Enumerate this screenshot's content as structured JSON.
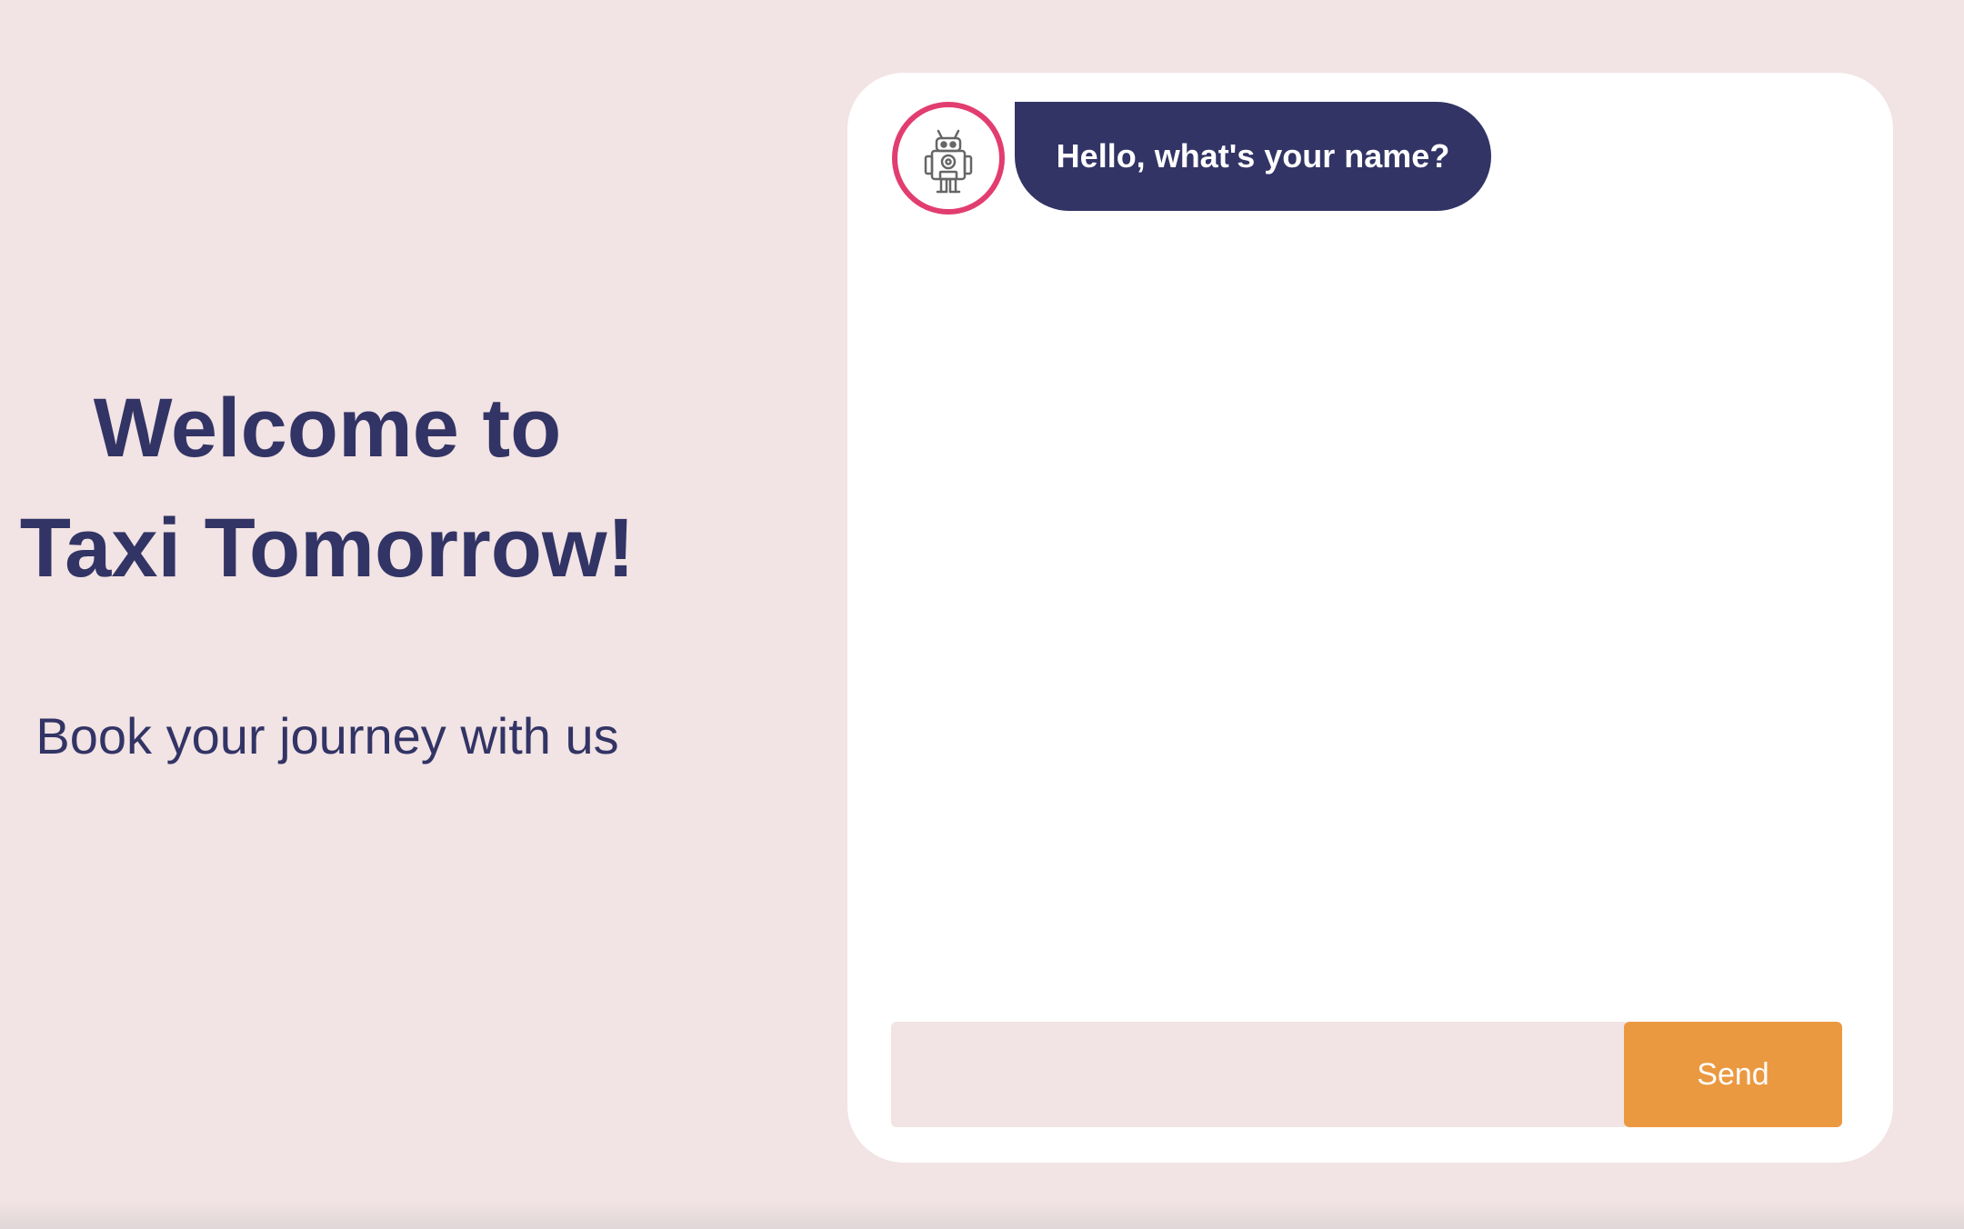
{
  "hero": {
    "title_line1": "Welcome to",
    "title_line2": "Taxi Tomorrow!",
    "subtitle": "Book your journey with us"
  },
  "chat": {
    "avatar_icon": "robot-icon",
    "messages": [
      {
        "sender": "bot",
        "text": "Hello, what's your name?"
      }
    ],
    "input": {
      "value": "",
      "placeholder": ""
    },
    "send_label": "Send"
  },
  "colors": {
    "background": "#f2e3e4",
    "primary": "#323465",
    "accent": "#e23d70",
    "button": "#eb9940",
    "card": "#ffffff"
  }
}
